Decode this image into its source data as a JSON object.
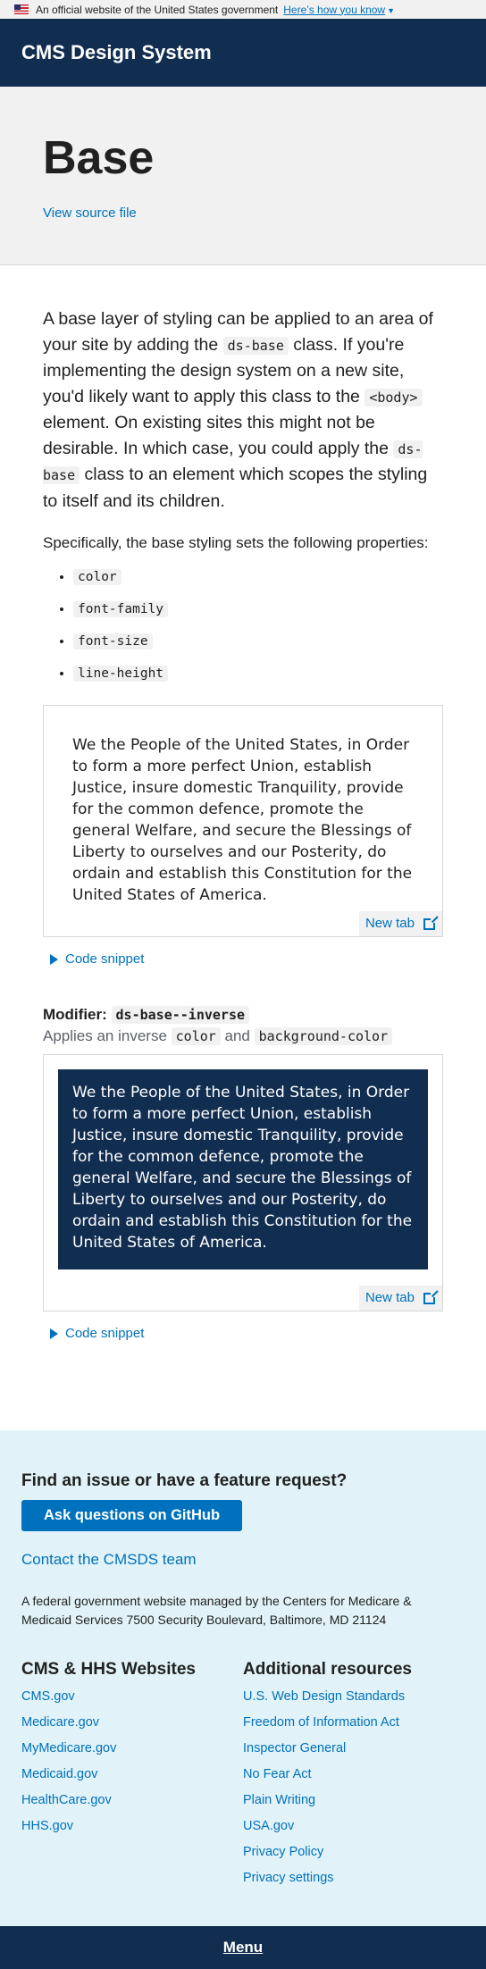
{
  "gov_banner": {
    "text": "An official website of the United States government",
    "link": "Here’s how you know"
  },
  "header": {
    "title": "CMS Design System"
  },
  "hero": {
    "title": "Base",
    "view_source": "View source file"
  },
  "intro": {
    "p1_a": "A base layer of styling can be applied to an area of your site by adding the ",
    "p1_code1": "ds-base",
    "p1_b": " class. If you're implementing the design system on a new site, you'd likely want to apply this class to the ",
    "p1_code2": "<body>",
    "p1_c": " element. On existing sites this might not be desirable. In which case, you could apply the ",
    "p1_code3": "ds-base",
    "p1_d": " class to an element which scopes the styling to itself and its children.",
    "p2": "Specifically, the base styling sets the following properties:",
    "properties": [
      "color",
      "font-family",
      "font-size",
      "line-height"
    ]
  },
  "example": {
    "text": "We the People of the United States, in Order to form a more perfect Union, establish Justice, insure domestic Tranquility, provide for the common defence, promote the general Welfare, and secure the Blessings of Liberty to ourselves and our Posterity, do ordain and establish this Constitution for the United States of America.",
    "new_tab": "New tab",
    "snippet": "Code snippet"
  },
  "modifier": {
    "label": "Modifier:",
    "code": "ds-base--inverse",
    "applies_a": "Applies an inverse ",
    "applies_code1": "color",
    "applies_b": " and ",
    "applies_code2": "background-color",
    "new_tab": "New tab",
    "snippet": "Code snippet"
  },
  "footer": {
    "heading": "Find an issue or have a feature request?",
    "github_button": "Ask questions on GitHub",
    "contact": "Contact the CMSDS team",
    "fed_text": "A federal government website managed by the Centers for Medicare & Medicaid Services 7500 Security Boulevard, Baltimore, MD 21124",
    "col1": {
      "title": "CMS & HHS Websites",
      "links": [
        "CMS.gov",
        "Medicare.gov",
        "MyMedicare.gov",
        "Medicaid.gov",
        "HealthCare.gov",
        "HHS.gov"
      ]
    },
    "col2": {
      "title": "Additional resources",
      "links": [
        "U.S. Web Design Standards",
        "Freedom of Information Act",
        "Inspector General",
        "No Fear Act",
        "Plain Writing",
        "USA.gov",
        "Privacy Policy",
        "Privacy settings"
      ]
    }
  },
  "menu": {
    "label": "Menu"
  }
}
